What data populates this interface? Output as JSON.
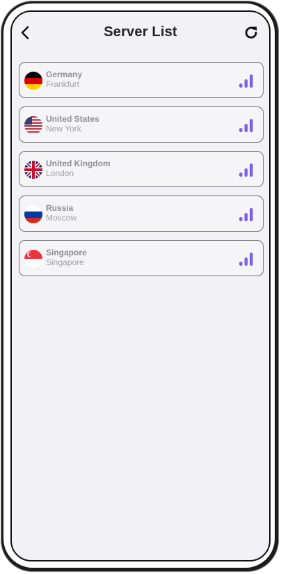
{
  "header": {
    "title": "Server List",
    "back_icon": "chevron-left-icon",
    "refresh_icon": "refresh-icon"
  },
  "servers": [
    {
      "country": "Germany",
      "city": "Frankfurt",
      "flag": "germany-flag-icon"
    },
    {
      "country": "United States",
      "city": "New York",
      "flag": "usa-flag-icon"
    },
    {
      "country": "United Kingdom",
      "city": "London",
      "flag": "uk-flag-icon"
    },
    {
      "country": "Russia",
      "city": "Moscow",
      "flag": "russia-flag-icon"
    },
    {
      "country": "Singapore",
      "city": "Singapore",
      "flag": "singapore-flag-icon"
    }
  ],
  "colors": {
    "signal": "#7d5fe8",
    "background": "#f1f1f6",
    "border": "#707075"
  }
}
